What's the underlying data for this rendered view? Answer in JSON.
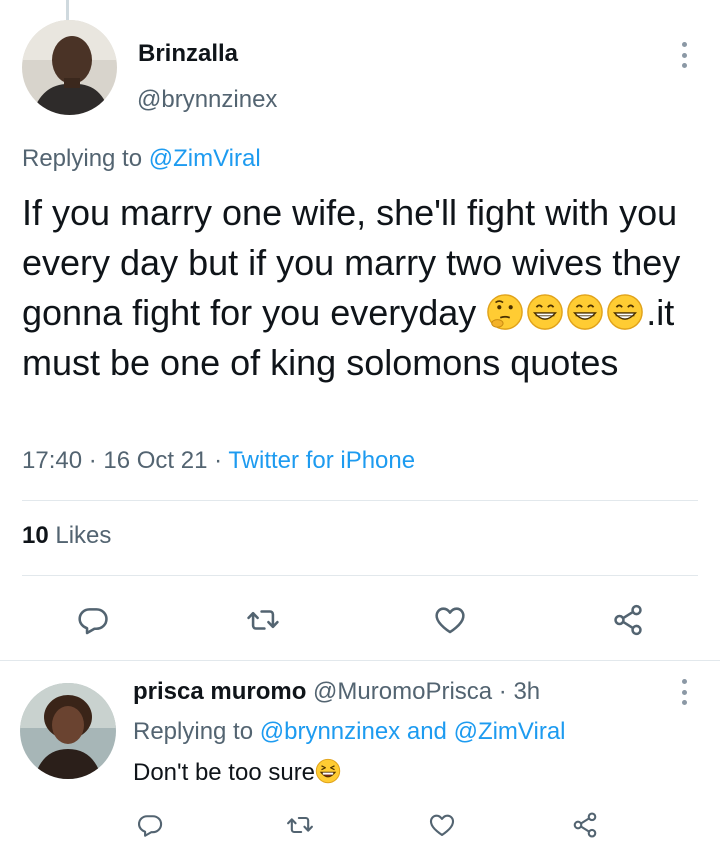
{
  "main_tweet": {
    "display_name": "Brinzalla",
    "handle": "@brynnzinex",
    "replying_prefix": "Replying to ",
    "replying_to": "@ZimViral",
    "text_part1": "If you marry one wife, she'll fight with you every day but if you marry two wives they gonna fight for you everyday ",
    "text_part2": ".it must be one of king solomons quotes",
    "emojis": [
      "thinking-face",
      "grinning-face",
      "grinning-face",
      "grinning-face"
    ],
    "time": "17:40 · 16 Oct 21 · ",
    "source": "Twitter for iPhone",
    "likes_count": "10",
    "likes_label": " Likes"
  },
  "reply_tweet": {
    "display_name": "prisca muromo",
    "handle_time": " @MuromoPrisca · 3h",
    "replying_prefix": "Replying to ",
    "replying_to_1": "@brynnzinex",
    "replying_and": " and ",
    "replying_to_2": "@ZimViral",
    "text": "Don't be too sure",
    "emoji": "laughing-face"
  },
  "actions": {
    "icons": [
      "reply-icon",
      "retweet-icon",
      "like-icon",
      "share-icon"
    ]
  },
  "colors": {
    "accent": "#1d9bf0",
    "secondary_text": "#536471",
    "primary_text": "#0f1419",
    "icon": "#536471",
    "divider": "#e2e8ec"
  }
}
